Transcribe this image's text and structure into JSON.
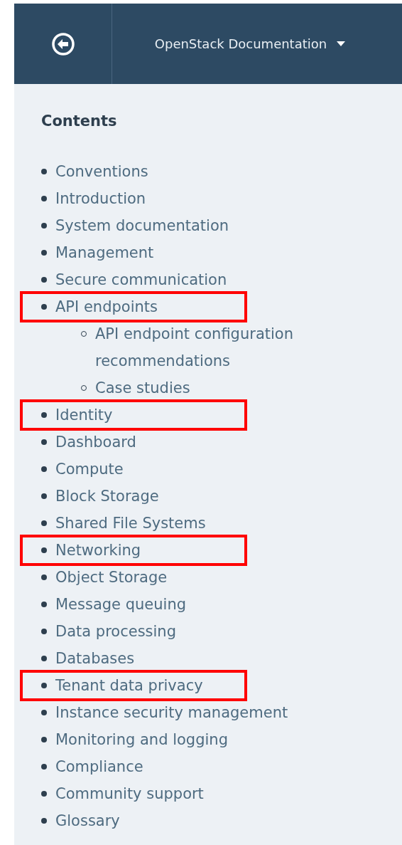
{
  "header": {
    "title": "OpenStack Documentation"
  },
  "contents": {
    "heading": "Contents",
    "items": [
      {
        "title": "Conventions",
        "highlighted": false
      },
      {
        "title": "Introduction",
        "highlighted": false
      },
      {
        "title": "System documentation",
        "highlighted": false
      },
      {
        "title": "Management",
        "highlighted": false
      },
      {
        "title": "Secure communication",
        "highlighted": false
      },
      {
        "title": "API endpoints",
        "highlighted": true,
        "children": [
          {
            "title": "API endpoint configuration recommendations"
          },
          {
            "title": "Case studies"
          }
        ]
      },
      {
        "title": "Identity",
        "highlighted": true
      },
      {
        "title": "Dashboard",
        "highlighted": false
      },
      {
        "title": "Compute",
        "highlighted": false
      },
      {
        "title": "Block Storage",
        "highlighted": false
      },
      {
        "title": "Shared File Systems",
        "highlighted": false
      },
      {
        "title": "Networking",
        "highlighted": true
      },
      {
        "title": "Object Storage",
        "highlighted": false
      },
      {
        "title": "Message queuing",
        "highlighted": false
      },
      {
        "title": "Data processing",
        "highlighted": false
      },
      {
        "title": "Databases",
        "highlighted": false
      },
      {
        "title": "Tenant data privacy",
        "highlighted": true
      },
      {
        "title": "Instance security management",
        "highlighted": false
      },
      {
        "title": "Monitoring and logging",
        "highlighted": false
      },
      {
        "title": "Compliance",
        "highlighted": false
      },
      {
        "title": "Community support",
        "highlighted": false
      },
      {
        "title": "Glossary",
        "highlighted": false
      }
    ]
  }
}
